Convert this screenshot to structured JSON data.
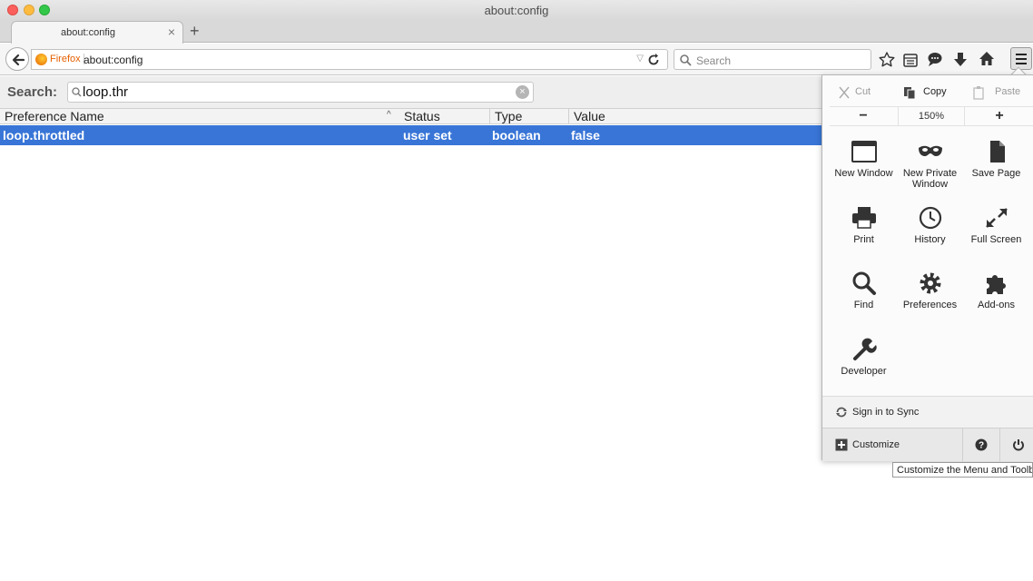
{
  "window": {
    "title": "about:config"
  },
  "tabs": [
    {
      "label": "about:config",
      "close": "×"
    }
  ],
  "new_tab": "+",
  "nav": {
    "identity_label": "Firefox",
    "url": "about:config",
    "search_placeholder": "Search"
  },
  "config": {
    "search_label": "Search:",
    "filter_value": "loop.thr",
    "clear_glyph": "×",
    "columns": [
      "Preference Name",
      "Status",
      "Type",
      "Value"
    ],
    "sort_indicator": "^",
    "rows": [
      {
        "name": "loop.throttled",
        "status": "user set",
        "type": "boolean",
        "value": "false"
      }
    ]
  },
  "menu_panel": {
    "edit": {
      "cut": "Cut",
      "copy": "Copy",
      "paste": "Paste"
    },
    "zoom": {
      "minus": "−",
      "level": "150%",
      "plus": "+"
    },
    "items": [
      {
        "label": "New Window",
        "icon": "new-window-icon"
      },
      {
        "label": "New Private Window",
        "icon": "private-window-icon"
      },
      {
        "label": "Save Page",
        "icon": "save-page-icon"
      },
      {
        "label": "Print",
        "icon": "print-icon"
      },
      {
        "label": "History",
        "icon": "history-icon"
      },
      {
        "label": "Full Screen",
        "icon": "fullscreen-icon"
      },
      {
        "label": "Find",
        "icon": "find-icon"
      },
      {
        "label": "Preferences",
        "icon": "gear-icon"
      },
      {
        "label": "Add-ons",
        "icon": "puzzle-icon"
      },
      {
        "label": "Developer",
        "icon": "wrench-icon"
      }
    ],
    "sync_label": "Sign in to Sync",
    "customize_label": "Customize"
  },
  "tooltip": "Customize the Menu and Toolbars",
  "colors": {
    "selection": "#3875d7",
    "identity": "#e66000"
  }
}
